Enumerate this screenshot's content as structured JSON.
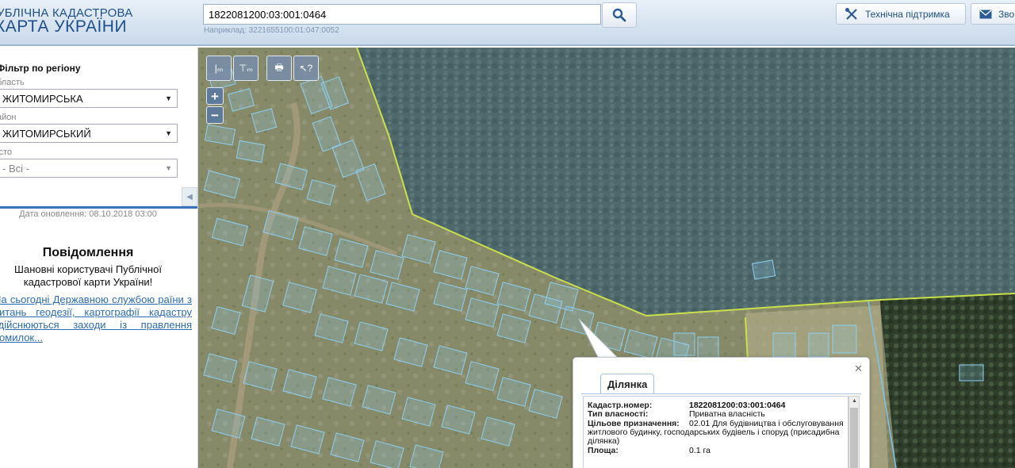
{
  "header": {
    "logo_line1": "УБЛІЧНА КАДАСТРОВА",
    "logo_line2": "КАРТА УКРАЇНИ",
    "search_value": "1822081200:03:001:0464",
    "example": "Наприклад: 3221655100:01:047:0052",
    "support_label": "Технічна підтримка",
    "feedback_label": "Зво"
  },
  "sidebar": {
    "filter_title": "Фільтр по регіону",
    "region_label": "бласть",
    "region_value": "ЖИТОМИРСЬКА",
    "district_label": "айон",
    "district_value": "ЖИТОМИРСЬКИЙ",
    "city_label": "істо",
    "city_value": "- Всі -",
    "update": "Дата оновлення: 08.10.2018 03:00",
    "notice_title": "Повідомлення",
    "notice_text": "Шановні користувачі Публічної кадастрової карти України!",
    "notice_link": "На сьогодні Державною службою раїни з питань геодезії, картографії кадастру здійснюються заходи із правлення помилок..."
  },
  "map": {
    "toolbar": [
      "I м",
      "I мг",
      "print",
      "pointer ?"
    ],
    "zoom_in": "+",
    "zoom_out": "−",
    "colors": {
      "forest": "#3c4f45",
      "field": "#8b8d6b",
      "parcel": "#7fc4ec",
      "boundary": "#c8e04a"
    }
  },
  "popup": {
    "tab": "Ділянка",
    "close": "✕",
    "rows": [
      {
        "k": "Кадастр.номер:",
        "v": "1822081200:03:001:0464",
        "bold": true
      },
      {
        "k": "Тип власності:",
        "v": "Приватна власність"
      },
      {
        "k": "Цільове призначення:",
        "v": "02.01 Для будівництва і обслуговування житлового будинку, господарських будівель і споруд (присадибна ділянка)"
      },
      {
        "k": "Площа:",
        "v": "0.1 га"
      }
    ]
  }
}
